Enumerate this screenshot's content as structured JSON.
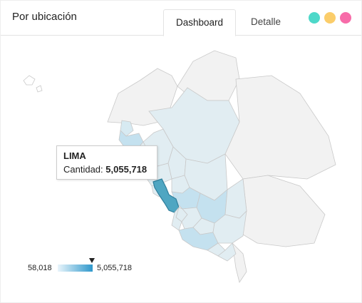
{
  "header": {
    "title": "Por ubicación",
    "tabs": [
      {
        "label": "Dashboard",
        "active": true
      },
      {
        "label": "Detalle",
        "active": false
      }
    ],
    "dots": [
      {
        "name": "teal-dot",
        "color": "#4dd8c9"
      },
      {
        "name": "yellow-dot",
        "color": "#fbcd6a"
      },
      {
        "name": "pink-dot",
        "color": "#f76ca9"
      }
    ]
  },
  "map": {
    "tooltip": {
      "region": "LIMA",
      "label": "Cantidad:",
      "value": "5,055,718"
    },
    "legend": {
      "min": "58,018",
      "max": "5,055,718"
    },
    "colors": {
      "highlight": "#4fa6c2",
      "region_low": "#e1edf2",
      "region_mid": "#c4e1ef",
      "neighbor": "#f2f2f2",
      "border": "#c9c9c9"
    }
  }
}
